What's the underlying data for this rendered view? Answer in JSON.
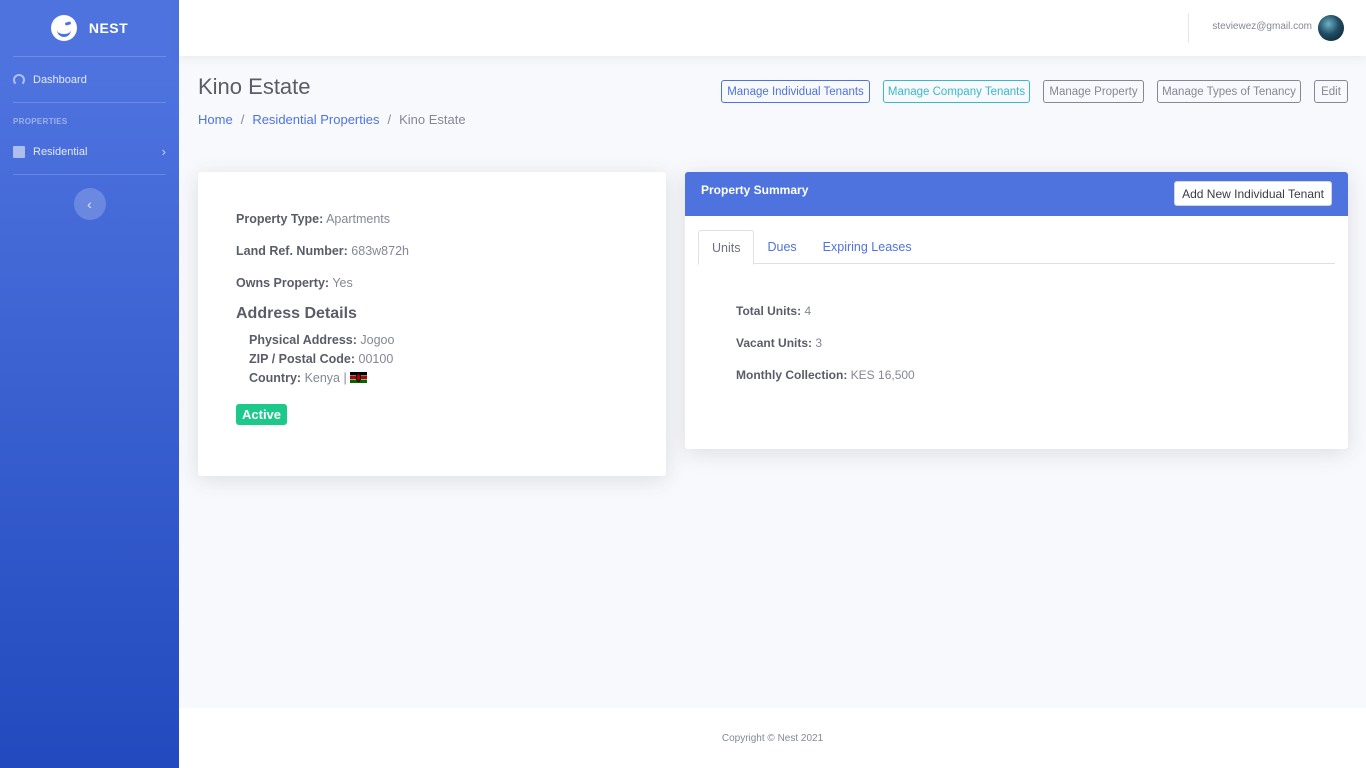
{
  "brand": {
    "name": "NEST"
  },
  "sidebar": {
    "dashboard_label": "Dashboard",
    "heading": "PROPERTIES",
    "residential_label": "Residential"
  },
  "topbar": {
    "user_email": "steviewez@gmail.com"
  },
  "page": {
    "title": "Kino Estate",
    "breadcrumb": {
      "home": "Home",
      "residential": "Residential Properties",
      "current": "Kino Estate"
    }
  },
  "actions": {
    "manage_individual": "Manage Individual Tenants",
    "manage_company": "Manage Company Tenants",
    "manage_property": "Manage Property",
    "manage_types": "Manage Types of Tenancy",
    "edit": "Edit"
  },
  "property": {
    "type_label": "Property Type:",
    "type_value": "Apartments",
    "landref_label": "Land Ref. Number:",
    "landref_value": "683w872h",
    "owns_label": "Owns Property:",
    "owns_value": "Yes",
    "address_heading": "Address Details",
    "physical_label": "Physical Address:",
    "physical_value": "Jogoo",
    "zip_label": "ZIP / Postal Code:",
    "zip_value": "00100",
    "country_label": "Country:",
    "country_value": "Kenya |",
    "status": "Active"
  },
  "summary": {
    "title": "Property Summary",
    "add_button": "Add New Individual Tenant",
    "tabs": [
      "Units",
      "Dues",
      "Expiring Leases"
    ],
    "total_label": "Total Units:",
    "total_value": "4",
    "vacant_label": "Vacant Units:",
    "vacant_value": "3",
    "monthly_label": "Monthly Collection:",
    "monthly_value": "KES 16,500"
  },
  "footer": {
    "copyright": "Copyright © Nest 2021"
  },
  "colors": {
    "primary": "#4e73df",
    "info": "#36b9cc",
    "success": "#1cc88a",
    "secondary": "#858796"
  }
}
